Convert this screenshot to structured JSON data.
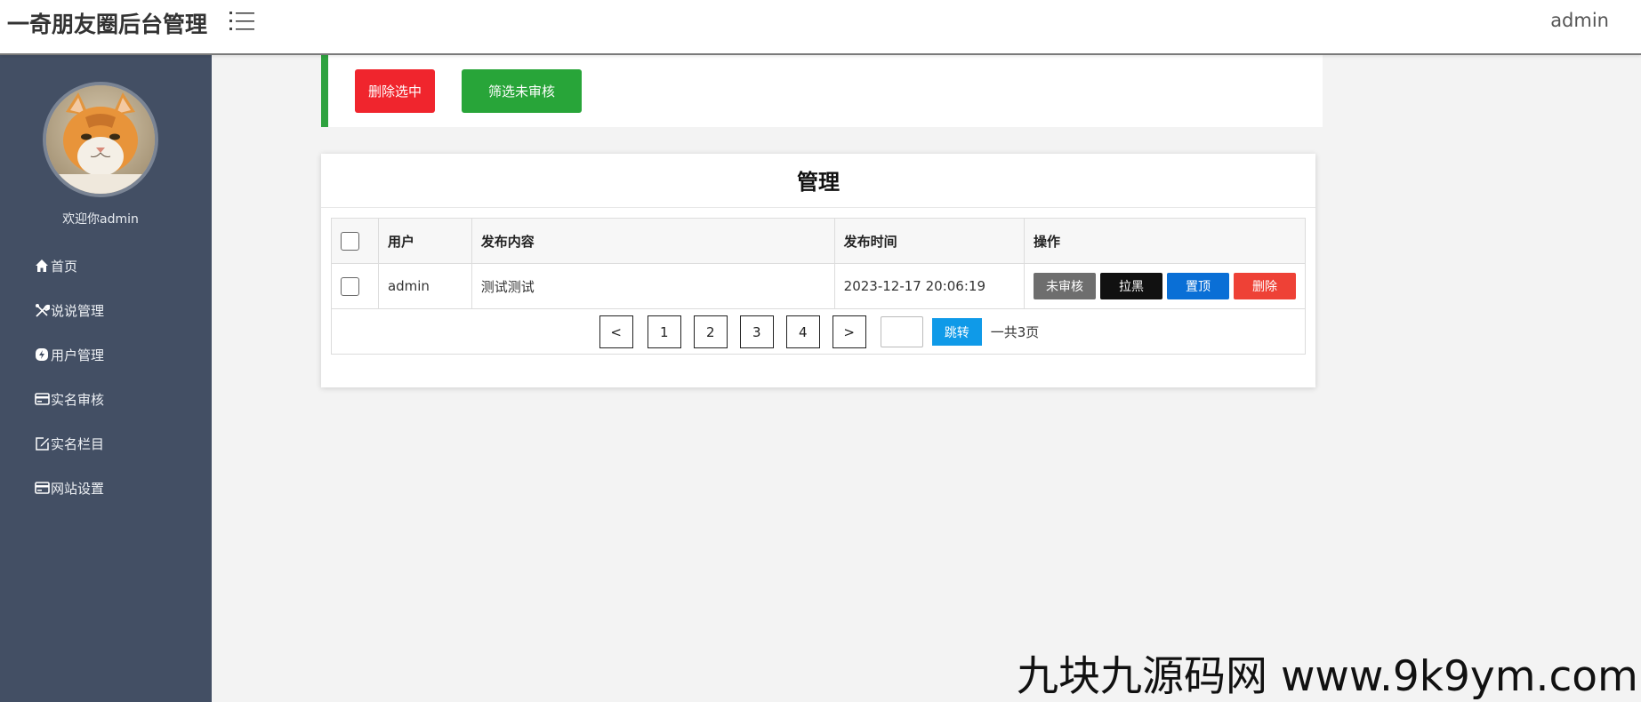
{
  "header": {
    "brand": "一奇朋友圈后台管理",
    "user": "admin",
    "menu_icon": "list-menu-icon"
  },
  "sidebar": {
    "welcome": "欢迎你admin",
    "items": [
      {
        "label": "首页",
        "icon": "home-icon"
      },
      {
        "label": "说说管理",
        "icon": "tools-icon"
      },
      {
        "label": "用户管理",
        "icon": "lightning-circle-icon"
      },
      {
        "label": "实名审核",
        "icon": "card-icon"
      },
      {
        "label": "实名栏目",
        "icon": "edit-icon"
      },
      {
        "label": "网站设置",
        "icon": "window-icon"
      }
    ]
  },
  "actions": {
    "delete_selected": "删除选中",
    "filter_unreviewed": "筛选未审核"
  },
  "panel": {
    "title": "管理",
    "columns": [
      "用户",
      "发布内容",
      "发布时间",
      "操作"
    ],
    "rows": [
      {
        "user": "admin",
        "content": "测试测试",
        "time": "2023-12-17 20:06:19",
        "ops": {
          "unaudit": "未审核",
          "block": "拉黑",
          "pin": "置顶",
          "delete": "删除"
        }
      }
    ]
  },
  "pagination": {
    "prev": "<",
    "pages": [
      "1",
      "2",
      "3",
      "4"
    ],
    "next": ">",
    "input_value": "",
    "go": "跳转",
    "total": "一共3页"
  },
  "watermark": "九块九源码网 www.9k9ym.com",
  "colors": {
    "sidebar_bg": "#434f64",
    "accent_green": "#2ea23f",
    "danger_red": "#f0252d",
    "primary_blue": "#0a6fd6",
    "go_blue": "#0f9ae8"
  }
}
